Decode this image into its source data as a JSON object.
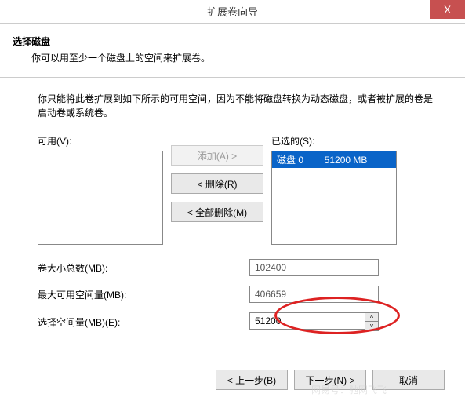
{
  "titlebar": {
    "title": "扩展卷向导",
    "close": "X"
  },
  "header": {
    "title": "选择磁盘",
    "desc": "你可以用至少一个磁盘上的空间来扩展卷。"
  },
  "instruction": "你只能将此卷扩展到如下所示的可用空间，因为不能将磁盘转换为动态磁盘，或者被扩展的卷是启动卷或系统卷。",
  "lists": {
    "available_label": "可用(V):",
    "selected_label": "已选的(S):",
    "selected_items": [
      "磁盘 0        51200 MB"
    ]
  },
  "buttons": {
    "add": "添加(A) >",
    "remove": "< 删除(R)",
    "remove_all": "< 全部删除(M)"
  },
  "fields": {
    "total_label": "卷大小总数(MB):",
    "total_value": "102400",
    "max_label": "最大可用空间量(MB):",
    "max_value": "406659",
    "select_label": "选择空间量(MB)(E):",
    "select_value": "51200"
  },
  "footer": {
    "back": "< 上一步(B)",
    "next": "下一步(N) >",
    "cancel": "取消"
  },
  "watermark": "网易号：驰网飞飞"
}
